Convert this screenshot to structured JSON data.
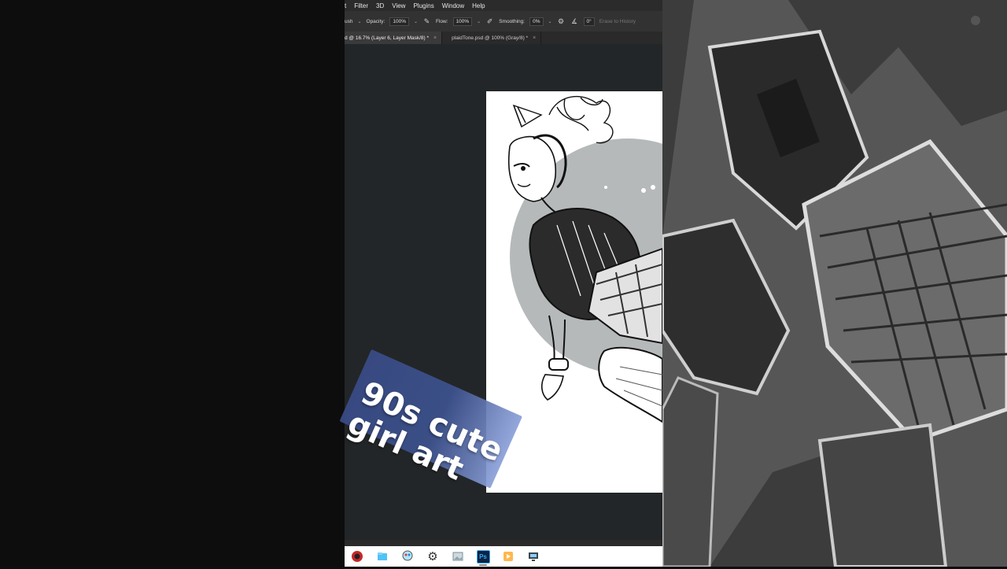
{
  "menubar": {
    "items": [
      "t",
      "Filter",
      "3D",
      "View",
      "Plugins",
      "Window",
      "Help"
    ]
  },
  "options": {
    "brush_label": "ush",
    "opacity_label": "Opacity:",
    "opacity_value": "100%",
    "flow_label": "Flow:",
    "flow_value": "100%",
    "smoothing_label": "Smoothing:",
    "smoothing_value": "0%",
    "angle_value": "0°",
    "erase_history_label": "Erase to History"
  },
  "tabs": [
    {
      "label": "d @ 16.7% (Layer 6, Layer Mask/8) *",
      "active": true
    },
    {
      "label": "plaidTone.psd @ 100% (Gray/8) *",
      "active": false
    }
  ],
  "overlay": {
    "title": "90s cute\ngirl art",
    "colors": {
      "badge_start": "#394c88",
      "badge_end": "#8a9fd8",
      "text": "#ffffff"
    }
  },
  "taskbar": {
    "icons": [
      "browser-icon",
      "file-explorer-icon",
      "paint-icon",
      "settings-icon",
      "photos-icon",
      "photoshop-icon",
      "media-player-icon",
      "remote-desktop-icon"
    ],
    "photoshop_label": "Ps"
  },
  "colors": {
    "app_bg": "#232628",
    "menubar_bg": "#2b2b2b",
    "optionsbar_bg": "#323232",
    "canvas_doc": "#ffffff",
    "circle_gray": "#b6b9ba"
  }
}
